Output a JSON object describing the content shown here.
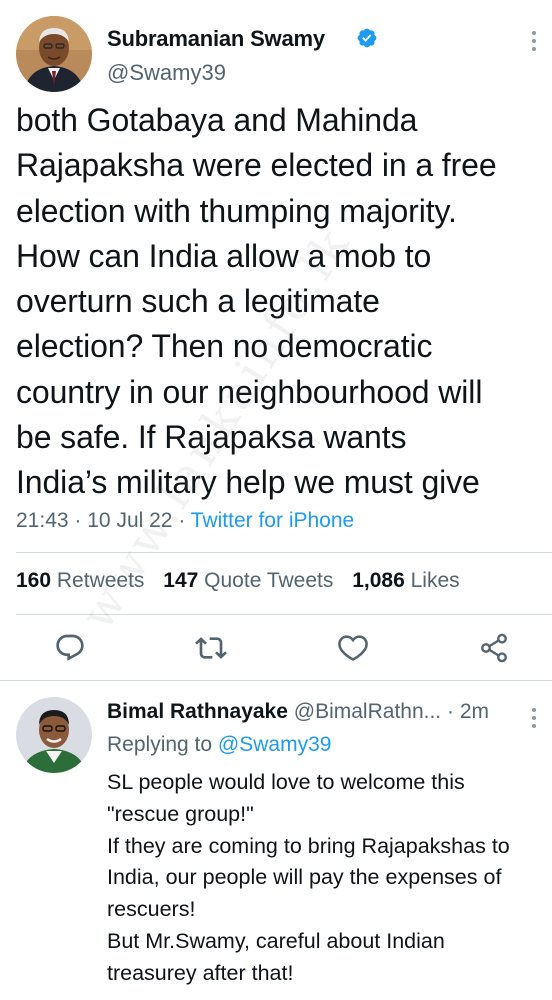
{
  "tweet": {
    "author_name": "Subramanian Swamy",
    "handle": "@Swamy39",
    "text_lines": [
      "both Gotabaya and Mahinda",
      "Rajapaksha were elected in a free",
      "election with thumping majority.",
      "How can India allow a mob to",
      "overturn such a  legitimate",
      "election? Then no democratic",
      "country in our neighbourhood will",
      "be safe. If Rajapaksa wants",
      "India’s military help we must give"
    ],
    "time": "21:43",
    "date": "10 Jul 22",
    "separator": "·",
    "source": "Twitter for iPhone",
    "stats": {
      "retweets_count": "160",
      "retweets_label": "Retweets",
      "quotes_count": "147",
      "quotes_label": "Quote Tweets",
      "likes_count": "1,086",
      "likes_label": "Likes"
    },
    "actions": [
      "reply-icon",
      "retweet-icon",
      "like-icon",
      "share-icon"
    ]
  },
  "reply": {
    "author_name": "Bimal Rathnayake",
    "handle": "@BimalRathn...",
    "separator": "·",
    "time_ago": "2m",
    "replying_to_label": "Replying to",
    "replying_to_handle": "@Swamy39",
    "text_lines": [
      "SL people would love to welcome this",
      "\"rescue group!\"",
      "If they are coming to bring Rajapakshas to",
      "India, our people will pay the expenses of",
      "rescuers!",
      "But Mr.Swamy, careful about Indian",
      "treasurey after that!"
    ]
  },
  "watermark": "www.lankainfo.lk",
  "colors": {
    "accent": "#1d9bf0",
    "secondary_text": "#536471",
    "primary_text": "#0f1419",
    "divider": "#cfd9de"
  }
}
